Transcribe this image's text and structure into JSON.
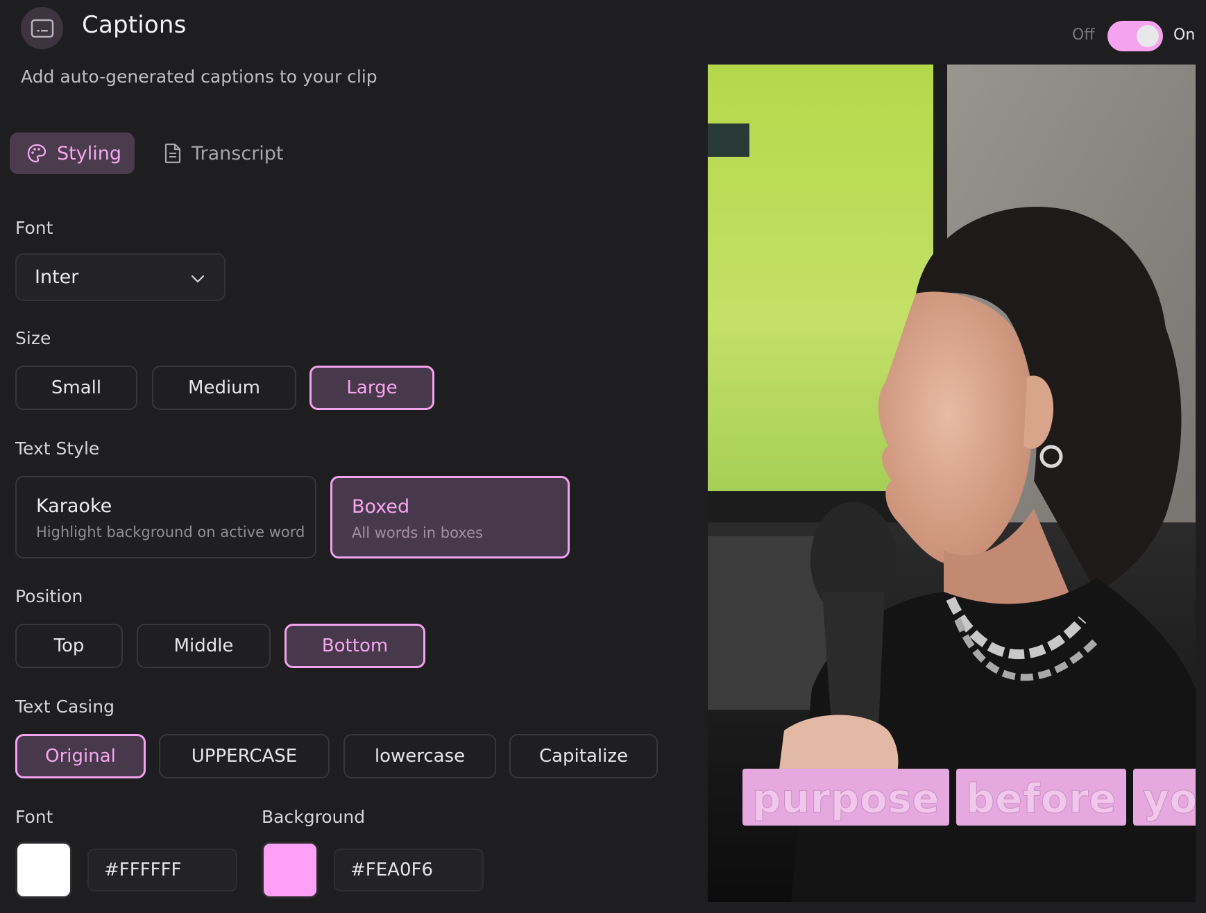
{
  "header": {
    "title": "Captions",
    "subtitle": "Add auto-generated captions to your clip"
  },
  "toggle": {
    "off_label": "Off",
    "on_label": "On",
    "state": "on"
  },
  "tabs": [
    {
      "label": "Styling",
      "icon": "palette-icon",
      "active": true
    },
    {
      "label": "Transcript",
      "icon": "document-icon",
      "active": false
    }
  ],
  "font_section": {
    "label": "Font",
    "selected": "Inter",
    "icon": "chevron-down-icon"
  },
  "size_section": {
    "label": "Size",
    "options": [
      "Small",
      "Medium",
      "Large"
    ],
    "selected": "Large"
  },
  "text_style_section": {
    "label": "Text Style",
    "options": [
      {
        "title": "Karaoke",
        "description": "Highlight background on active word"
      },
      {
        "title": "Boxed",
        "description": "All words in boxes"
      }
    ],
    "selected": "Boxed"
  },
  "position_section": {
    "label": "Position",
    "options": [
      "Top",
      "Middle",
      "Bottom"
    ],
    "selected": "Bottom"
  },
  "casing_section": {
    "label": "Text Casing",
    "options": [
      "Original",
      "UPPERCASE",
      "lowercase",
      "Capitalize"
    ],
    "selected": "Original"
  },
  "colors": {
    "font": {
      "label": "Font",
      "hex": "#FFFFFF"
    },
    "background": {
      "label": "Background",
      "hex": "#FEA0F6"
    }
  },
  "preview": {
    "caption_words": [
      "purpose",
      "before",
      "you"
    ]
  },
  "theme": {
    "accent": "#F3A2EF",
    "selected_bg": "#47394B",
    "panel_bg": "#1E1E20"
  }
}
